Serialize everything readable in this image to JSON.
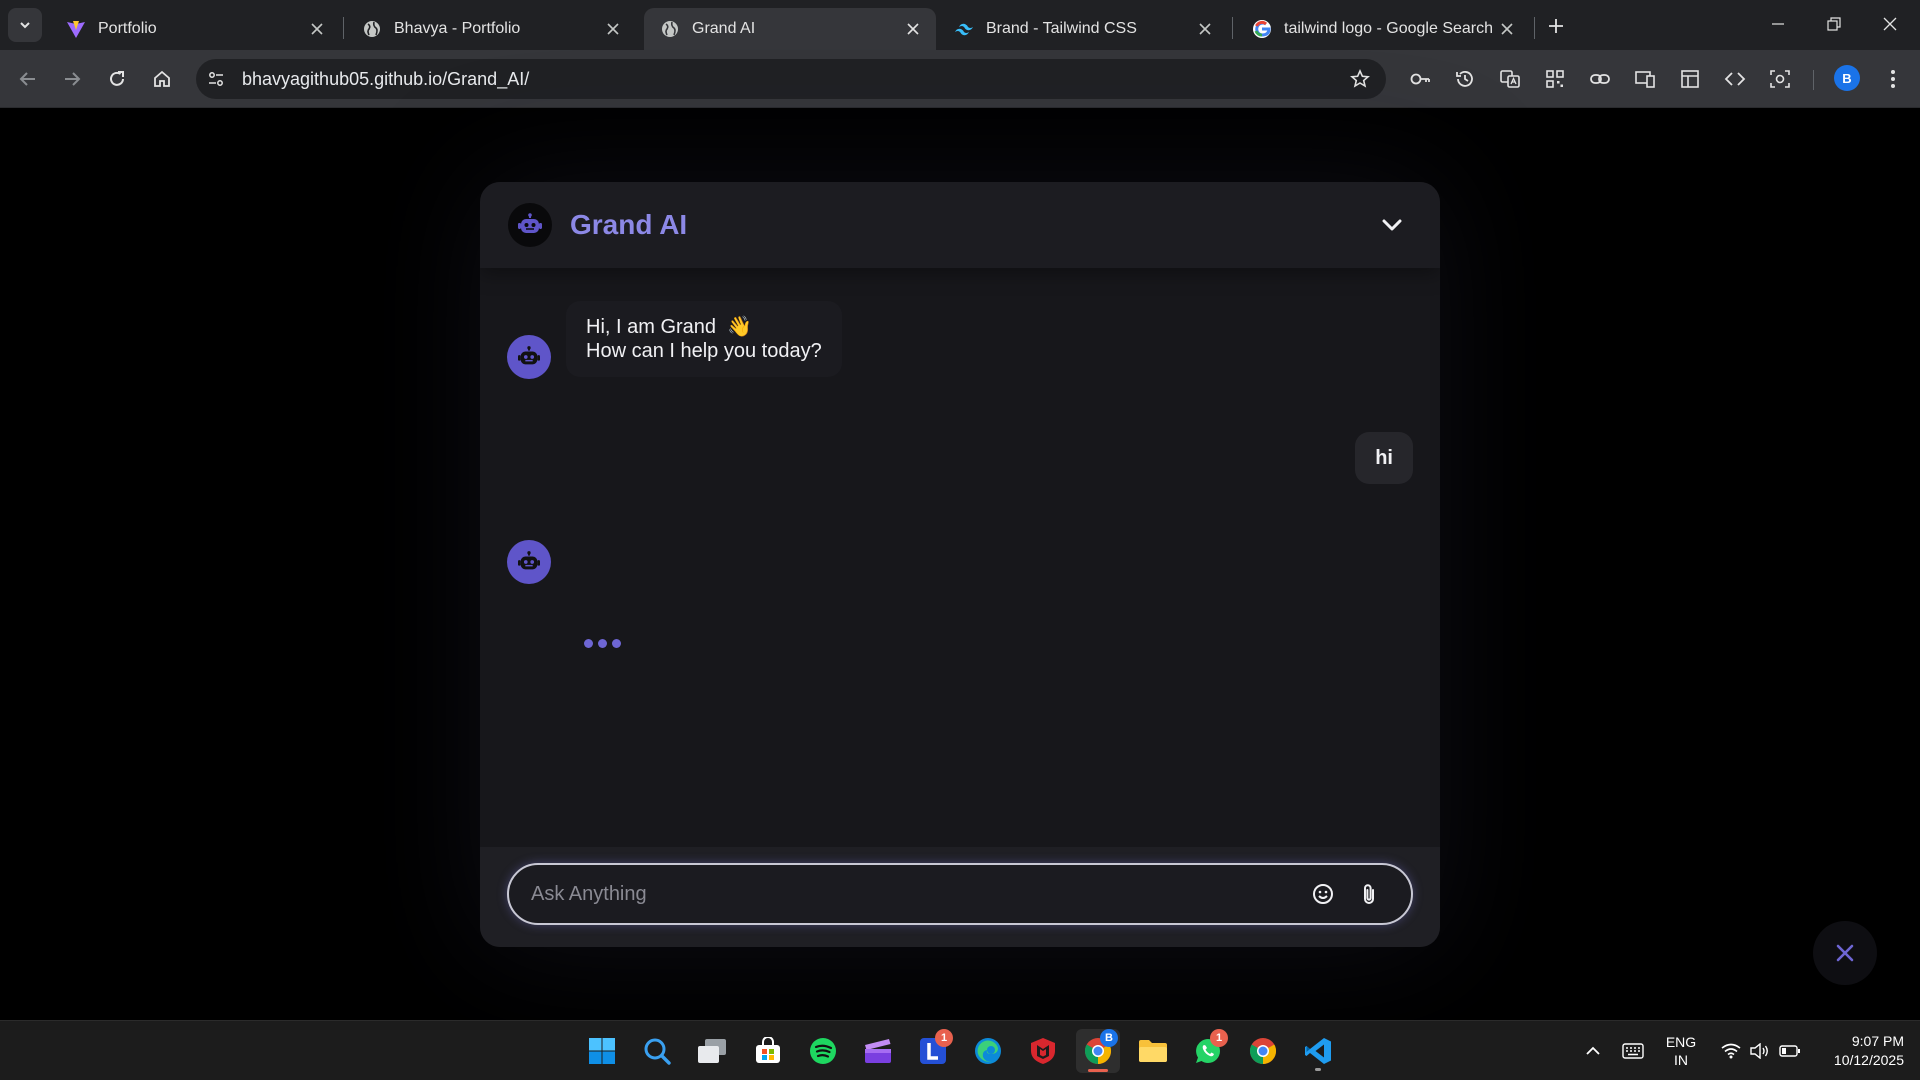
{
  "browser": {
    "tabs": [
      {
        "title": "Portfolio",
        "icon": "vite-logo-icon"
      },
      {
        "title": "Bhavya - Portfolio",
        "icon": "globe-icon"
      },
      {
        "title": "Grand AI",
        "icon": "globe-icon",
        "active": true
      },
      {
        "title": "Brand - Tailwind CSS",
        "icon": "tailwind-logo-icon"
      },
      {
        "title": "tailwind logo - Google Search",
        "icon": "google-logo-icon"
      }
    ],
    "url": "bhavyagithub05.github.io/Grand_AI/",
    "profile_initial": "B"
  },
  "chat": {
    "title": "Grand AI",
    "accent": "#8c88e6",
    "messages": [
      {
        "role": "bot",
        "line1": "Hi, I am Grand",
        "emoji": "👋",
        "line2": "How can I help you today?"
      },
      {
        "role": "user",
        "text": "hi"
      }
    ],
    "typing": true,
    "input": {
      "placeholder": "Ask Anything",
      "value": ""
    }
  },
  "taskbar": {
    "apps": [
      "windows-start",
      "search",
      "task-view",
      "microsoft-store",
      "spotify",
      "clapperboard",
      "l-app",
      "edge",
      "mcafee",
      "chrome-profile",
      "file-explorer",
      "whatsapp",
      "chrome",
      "vscode"
    ],
    "badges": {
      "l_app": "1",
      "chrome_profile": "B",
      "whatsapp": "1"
    },
    "language": {
      "line1": "ENG",
      "line2": "IN"
    },
    "time": "9:07 PM",
    "date": "10/12/2025"
  }
}
